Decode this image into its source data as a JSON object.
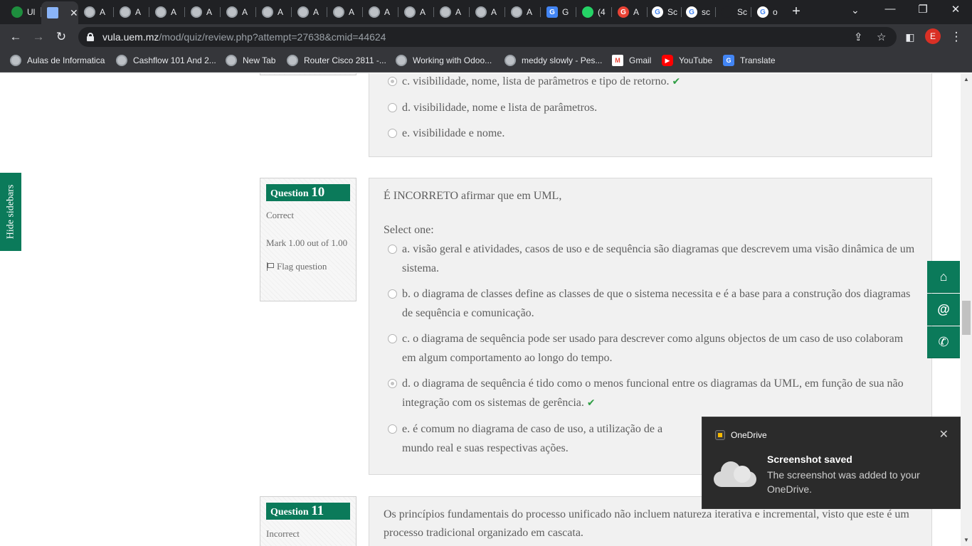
{
  "browser": {
    "tabs": [
      {
        "title": "Ul",
        "icon": "grass-icon"
      },
      {
        "title": "",
        "icon": "texture-icon",
        "active": true
      },
      {
        "title": "A",
        "icon": "globe-icon"
      },
      {
        "title": "A",
        "icon": "globe-icon"
      },
      {
        "title": "A",
        "icon": "globe-icon"
      },
      {
        "title": "A",
        "icon": "globe-icon"
      },
      {
        "title": "A",
        "icon": "globe-icon"
      },
      {
        "title": "A",
        "icon": "globe-icon"
      },
      {
        "title": "A",
        "icon": "globe-icon"
      },
      {
        "title": "A",
        "icon": "globe-icon"
      },
      {
        "title": "A",
        "icon": "globe-icon"
      },
      {
        "title": "A",
        "icon": "globe-icon"
      },
      {
        "title": "A",
        "icon": "globe-icon"
      },
      {
        "title": "A",
        "icon": "globe-icon"
      },
      {
        "title": "A",
        "icon": "globe-icon"
      },
      {
        "title": "G",
        "icon": "translate-icon"
      },
      {
        "title": "(4",
        "icon": "whatsapp-icon"
      },
      {
        "title": "A",
        "icon": "google-red-icon"
      },
      {
        "title": "Sc",
        "icon": "google-icon"
      },
      {
        "title": "sc",
        "icon": "google-icon"
      },
      {
        "title": "Sc",
        "icon": "dark-icon"
      },
      {
        "title": "o",
        "icon": "google-icon"
      }
    ],
    "new_tab": "+",
    "url_host": "vula.uem.mz",
    "url_path": "/mod/quiz/review.php?attempt=27638&cmid=44624",
    "profile_initial": "E",
    "bookmarks": [
      {
        "label": "Aulas de Informatica",
        "icon": "globe-icon"
      },
      {
        "label": "Cashflow 101 And 2...",
        "icon": "globe-icon"
      },
      {
        "label": "New Tab",
        "icon": "globe-icon"
      },
      {
        "label": "Router Cisco 2811 -...",
        "icon": "globe-icon"
      },
      {
        "label": "Working with Odoo...",
        "icon": "globe-icon"
      },
      {
        "label": "meddy slowly - Pes...",
        "icon": "globe-icon"
      },
      {
        "label": "Gmail",
        "icon": "gmail-icon"
      },
      {
        "label": "YouTube",
        "icon": "youtube-icon"
      },
      {
        "label": "Translate",
        "icon": "translate-icon"
      }
    ]
  },
  "sidebar_toggle": "Hide sidebars",
  "prev_question": {
    "answers": [
      {
        "text": "c. visibilidade, nome, lista de parâmetros e tipo de retorno.",
        "selected": true,
        "correct": true
      },
      {
        "text": "d. visibilidade, nome e lista de parâmetros.",
        "selected": false,
        "correct": false
      },
      {
        "text": "e.  visibilidade e nome.",
        "selected": false,
        "correct": false
      }
    ]
  },
  "question10": {
    "label": "Question",
    "number": "10",
    "state": "Correct",
    "grade": "Mark 1.00 out of 1.00",
    "flag": "Flag question",
    "text": "É INCORRETO afirmar que em UML,",
    "prompt": "Select one:",
    "answers": [
      {
        "text": "a. visão geral e atividades, casos de uso e de sequência são diagramas que descrevem uma visão dinâmica de um sistema.",
        "selected": false,
        "correct": false
      },
      {
        "text": "b. o diagrama de classes define as classes de que o sistema necessita e é a base para a construção dos diagramas de sequência e comunicação.",
        "selected": false,
        "correct": false
      },
      {
        "text": "c. o diagrama de sequência pode ser usado para descrever como alguns objectos de um caso de uso colaboram em algum comportamento ao longo do tempo.",
        "selected": false,
        "correct": false
      },
      {
        "text": "d. o diagrama de sequência é tido como o menos funcional entre os diagramas da UML, em função de sua não integração com os sistemas de gerência.",
        "selected": true,
        "correct": true
      },
      {
        "text": "e. é comum no diagrama de caso de uso, a utilização de a",
        "text_cont": "mundo real e suas respectivas ações.",
        "selected": false,
        "correct": false
      }
    ]
  },
  "question11": {
    "label": "Question",
    "number": "11",
    "state": "Incorrect",
    "text": "Os princípios fundamentais do processo unificado não incluem natureza iterativa e incremental, visto que este é um processo tradicional organizado em cascata."
  },
  "float_buttons": [
    "home-icon",
    "at-icon",
    "phone-icon"
  ],
  "toast": {
    "app": "OneDrive",
    "title": "Screenshot saved",
    "body": "The screenshot was added to your OneDrive."
  },
  "colors": {
    "accent": "#0b7a5a",
    "check": "#2f9e44"
  }
}
